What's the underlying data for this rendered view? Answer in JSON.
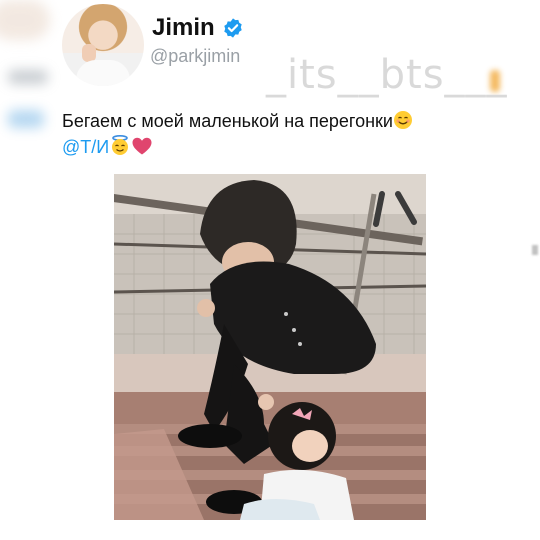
{
  "account": {
    "display_name": "Jimin",
    "handle": "@parkjimin"
  },
  "watermark": "_its__bts___",
  "tweet": {
    "text": "Бегаем с моей маленькой на перегонки",
    "mention": "@Т/И",
    "emojis": [
      "smiling-face-icon",
      "angel-face-icon",
      "heart-icon"
    ]
  },
  "colors": {
    "mention": "#1d9bf0",
    "verified": "#1d9bf0",
    "heart": "#e0456e",
    "handle": "#9aa0a6"
  }
}
